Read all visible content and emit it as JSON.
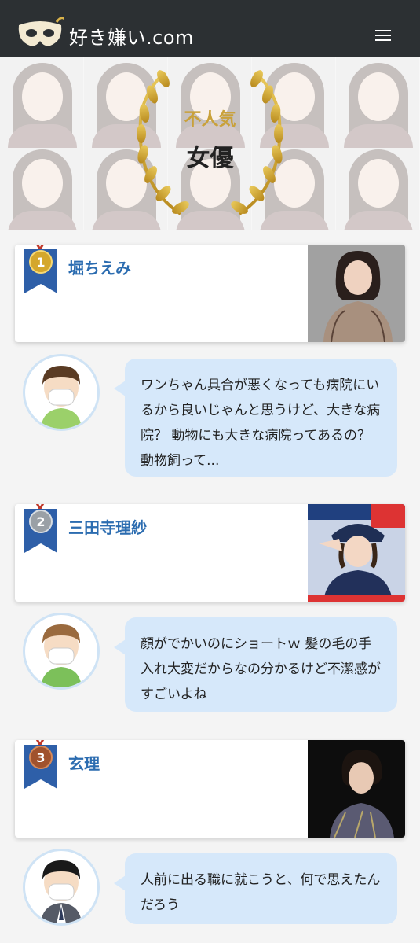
{
  "header": {
    "site_name": "好き嫌い.com",
    "logo_icon": "mask-logo-icon",
    "menu_icon": "hamburger-menu-icon"
  },
  "hero": {
    "subtitle": "不人気",
    "title": "女優"
  },
  "ranking": [
    {
      "rank": "1",
      "name": "堀ちえみ",
      "badge_color": "#d4a72c",
      "comment": "ワンちゃん具合が悪くなっても病院にいるから良いじゃんと思うけど、大きな病院？ 動物にも大きな病院ってあるの？ 動物飼って..."
    },
    {
      "rank": "2",
      "name": "三田寺理紗",
      "badge_color": "#9aa0a6",
      "comment": "顔がでかいのにショートｗ 髪の毛の手入れ大変だからなの分かるけど不潔感がすごいよね"
    },
    {
      "rank": "3",
      "name": "玄理",
      "badge_color": "#a0522d",
      "comment": "人前に出る職に就こうと、何で思えたんだろう"
    }
  ]
}
